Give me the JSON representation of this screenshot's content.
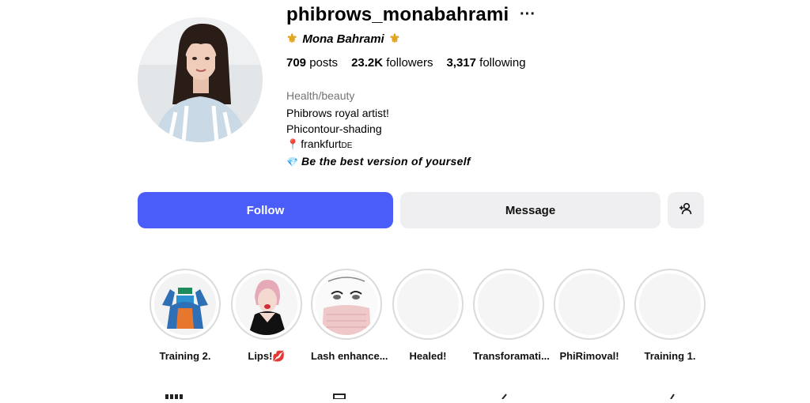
{
  "profile": {
    "username": "phibrows_monabahrami",
    "more_label": "···",
    "fullname": "Mona Bahrami",
    "stats": {
      "posts_count": "709",
      "posts_label": "posts",
      "followers_count": "23.2K",
      "followers_label": "followers",
      "following_count": "3,317",
      "following_label": "following"
    },
    "category": "Health/beauty",
    "bio": {
      "line1": "Phibrows royal artist!",
      "line2": "Phicontour-shading",
      "location": "frankfurt",
      "location_suffix": "DE",
      "tagline": "Be the best version of yourself"
    }
  },
  "actions": {
    "follow_label": "Follow",
    "message_label": "Message",
    "add_user_icon": "add-user-icon"
  },
  "highlights": [
    {
      "label": "Training 2."
    },
    {
      "label": "Lips!💋"
    },
    {
      "label": "Lash enhance..."
    },
    {
      "label": "Healed!"
    },
    {
      "label": "Transforamati..."
    },
    {
      "label": "PhiRimoval!"
    },
    {
      "label": "Training 1."
    }
  ],
  "colors": {
    "follow_button": "#4a5df9",
    "secondary_button": "#efeff1",
    "muted_text": "#737373"
  }
}
